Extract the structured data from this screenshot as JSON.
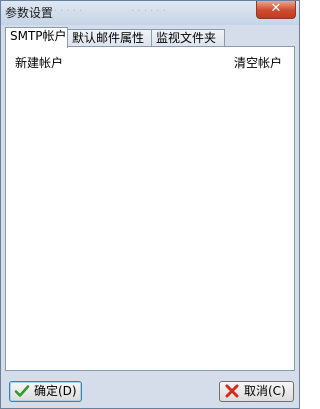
{
  "window": {
    "title": "参数设置",
    "close_symbol": "✕"
  },
  "tabs": [
    {
      "label": "SMTP帐户",
      "active": true
    },
    {
      "label": "默认邮件属性",
      "active": false
    },
    {
      "label": "监视文件夹",
      "active": false
    }
  ],
  "smtp_panel": {
    "new_account_label": "新建帐户",
    "clear_account_label": "清空帐户"
  },
  "footer": {
    "ok_label": "确定(D)",
    "cancel_label": "取消(C)"
  },
  "icons": {
    "ok_icon": "green-checkmark",
    "cancel_icon": "red-x"
  },
  "colors": {
    "check_green": "#2f9a2f",
    "cancel_red": "#d32a1e",
    "close_red": "#cf4a2e"
  }
}
